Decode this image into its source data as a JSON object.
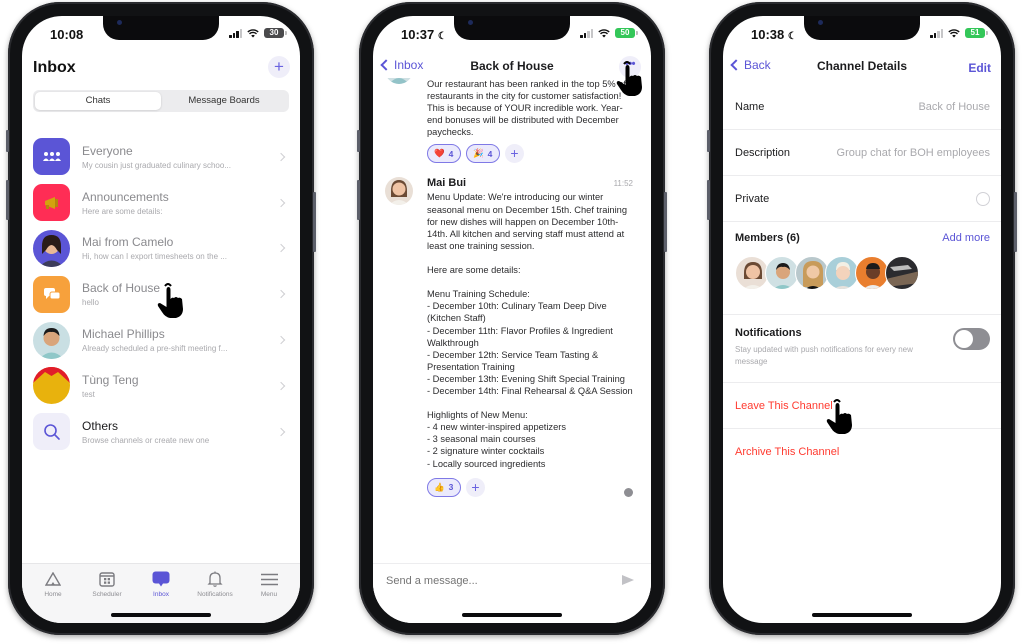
{
  "colors": {
    "accent": "#5b55d6",
    "danger": "#ff3b30",
    "everyone_icon": "#5b55d6",
    "announcements_icon": "#ff2d55",
    "back_of_house_icon": "#f7a13c",
    "others_icon_bg": "#efeef9"
  },
  "phone1": {
    "status": {
      "time": "10:08",
      "battery": "30"
    },
    "title": "Inbox",
    "add_icon": "plus-icon",
    "segments": [
      "Chats",
      "Message Boards"
    ],
    "active_segment": "Chats",
    "chats": [
      {
        "name": "Everyone",
        "preview": "My cousin just graduated culinary schoo...",
        "icon": "group-icon"
      },
      {
        "name": "Announcements",
        "preview": "Here are some details:",
        "icon": "megaphone-icon"
      },
      {
        "name": "Mai from Camelo",
        "preview": "Hi, how can I export timesheets on the ...",
        "icon": "avatar"
      },
      {
        "name": "Back of House",
        "preview": "hello",
        "icon": "chat-bubbles-icon"
      },
      {
        "name": "Michael Phillips",
        "preview": "Already scheduled a pre-shift meeting f...",
        "icon": "avatar"
      },
      {
        "name": "Tùng Teng",
        "preview": "test",
        "icon": "avatar"
      },
      {
        "name": "Others",
        "preview": "Browse channels or create new one",
        "icon": "search-icon"
      }
    ],
    "tabs": [
      {
        "label": "Home",
        "icon": "home-icon"
      },
      {
        "label": "Scheduler",
        "icon": "calendar-icon"
      },
      {
        "label": "Inbox",
        "icon": "chat-icon"
      },
      {
        "label": "Notifications",
        "icon": "bell-icon"
      },
      {
        "label": "Menu",
        "icon": "menu-icon"
      }
    ],
    "active_tab": "Inbox"
  },
  "phone2": {
    "status": {
      "time": "10:37",
      "battery": "50"
    },
    "back_label": "Inbox",
    "title": "Back of House",
    "messages": [
      {
        "body": "Our restaurant has been ranked in the top 5% of restaurants in the city for customer satisfaction! This is because of YOUR incredible work. Year-end bonuses will be distributed with December paychecks.",
        "reactions": [
          {
            "emoji": "❤️",
            "count": "4"
          },
          {
            "emoji": "🎉",
            "count": "4"
          }
        ]
      },
      {
        "author": "Mai Bui",
        "time": "11:52",
        "body": "Menu Update: We're introducing our winter seasonal menu on December 15th. Chef training for new dishes will happen on December 10th-14th. All kitchen and serving staff must attend at least one training session.\n\nHere are some details:\n\nMenu Training Schedule:\n- December 10th: Culinary Team Deep Dive (Kitchen Staff)\n- December 11th: Flavor Profiles & Ingredient Walkthrough\n- December 12th: Service Team Tasting & Presentation Training\n- December 13th: Evening Shift Special Training\n- December 14th: Final Rehearsal & Q&A Session\n\nHighlights of New Menu:\n- 4 new winter-inspired appetizers\n- 3 seasonal main courses\n- 2 signature winter cocktails\n- Locally sourced ingredients",
        "reactions": [
          {
            "emoji": "👍",
            "count": "3"
          }
        ]
      }
    ],
    "composer_placeholder": "Send a message..."
  },
  "phone3": {
    "status": {
      "time": "10:38",
      "battery": "51"
    },
    "back_label": "Back",
    "title": "Channel Details",
    "edit_label": "Edit",
    "name_label": "Name",
    "name_value": "Back of House",
    "description_label": "Description",
    "description_value": "Group chat for BOH employees",
    "private_label": "Private",
    "private_checked": false,
    "members_label": "Members (6)",
    "add_more_label": "Add more",
    "member_count": 6,
    "notifications_label": "Notifications",
    "notifications_desc": "Stay updated with push notifications for every new message",
    "notifications_on": false,
    "leave_label": "Leave This Channel",
    "archive_label": "Archive This Channel"
  }
}
